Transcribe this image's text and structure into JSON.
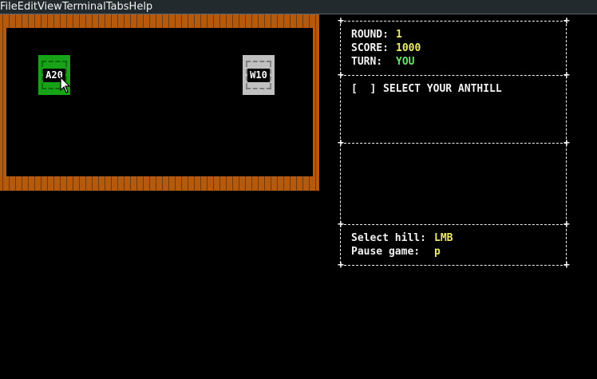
{
  "menu": {
    "items": [
      {
        "label": "File"
      },
      {
        "label": "Edit"
      },
      {
        "label": "View"
      },
      {
        "label": "Terminal"
      },
      {
        "label": "Tabs"
      },
      {
        "label": "Help"
      }
    ]
  },
  "board": {
    "hills": [
      {
        "label": "A20",
        "owner": "player",
        "color": "#16a316"
      },
      {
        "label": "W10",
        "owner": "neutral",
        "color": "#c0c0c0"
      }
    ],
    "wall_color": "#b55a0c"
  },
  "status": {
    "round_label": "ROUND:",
    "round_value": "1",
    "score_label": "SCORE:",
    "score_value": "1000",
    "turn_label": "TURN:",
    "turn_value": "YOU"
  },
  "prompt": {
    "checkbox": "[  ]",
    "text": "SELECT YOUR ANTHILL"
  },
  "controls": {
    "select_label": "Select hill:",
    "select_key": "LMB",
    "pause_label": "Pause game:",
    "pause_key": "p"
  },
  "colors": {
    "value_yellow": "#ecec6a",
    "value_green": "#6ae36a",
    "text": "#f2f2f2"
  }
}
